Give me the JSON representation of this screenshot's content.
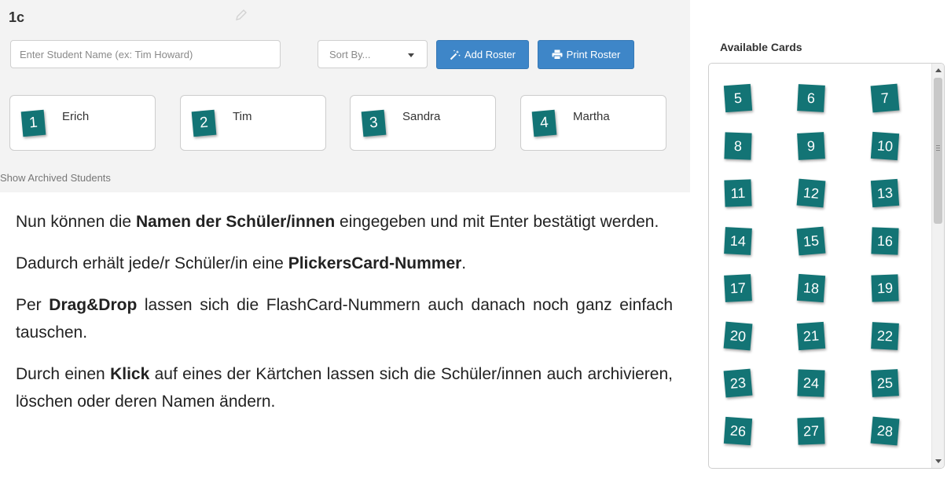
{
  "class": {
    "title": "1c"
  },
  "toolbar": {
    "student_placeholder": "Enter Student Name (ex: Tim Howard)",
    "sort_label": "Sort By...",
    "add_roster_label": "Add Roster",
    "print_roster_label": "Print Roster"
  },
  "students": [
    {
      "card": "1",
      "name": "Erich"
    },
    {
      "card": "2",
      "name": "Tim"
    },
    {
      "card": "3",
      "name": "Sandra"
    },
    {
      "card": "4",
      "name": "Martha"
    }
  ],
  "show_archived_label": "Show Archived Students",
  "available_cards": {
    "heading": "Available Cards",
    "numbers": [
      "5",
      "6",
      "7",
      "8",
      "9",
      "10",
      "11",
      "12",
      "13",
      "14",
      "15",
      "16",
      "17",
      "18",
      "19",
      "20",
      "21",
      "22",
      "23",
      "24",
      "25",
      "26",
      "27",
      "28"
    ]
  },
  "explanation": [
    [
      {
        "t": "Nun können die "
      },
      {
        "t": "Namen der Schüler/innen",
        "b": true
      },
      {
        "t": " eingegeben und mit Enter bestätigt werden."
      }
    ],
    [
      {
        "t": "Dadurch erhält jede/r Schüler/in eine "
      },
      {
        "t": "PlickersCard-Nummer",
        "b": true
      },
      {
        "t": "."
      }
    ],
    [
      {
        "t": "Per "
      },
      {
        "t": "Drag&Drop",
        "b": true
      },
      {
        "t": " lassen sich die FlashCard-Nummern auch danach noch ganz einfach tauschen."
      }
    ],
    [
      {
        "t": "Durch einen "
      },
      {
        "t": "Klick",
        "b": true
      },
      {
        "t": " auf eines der Kärtchen lassen sich die Schüler/innen auch archivieren, löschen oder deren Namen ändern."
      }
    ]
  ],
  "colors": {
    "card_teal": "#137475",
    "button_blue": "#3e86c8"
  },
  "icons": {
    "edit": "pencil-icon",
    "add_roster": "magic-wand-icon",
    "print_roster": "printer-icon",
    "sort": "caret-down-icon"
  }
}
